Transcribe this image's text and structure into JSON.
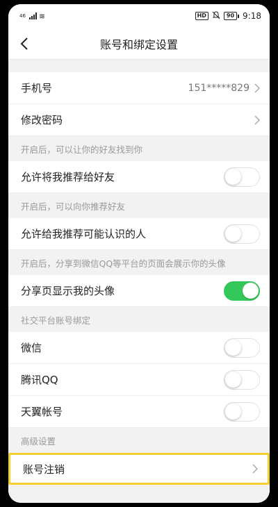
{
  "status_bar": {
    "network": "46",
    "hd": "HD",
    "battery": "90",
    "time": "9:18"
  },
  "nav": {
    "title": "账号和绑定设置"
  },
  "account": {
    "phone_label": "手机号",
    "phone_value": "151*****829",
    "password_label": "修改密码"
  },
  "sections": {
    "friends_find_hint": "开启后，可以让你的好友找到你",
    "recommend_me_label": "允许将我推荐给好友",
    "recommend_you_hint": "开启后，可以向你推荐好友",
    "recommend_known_label": "允许给我推荐可能认识的人",
    "share_avatar_hint": "开启后，分享到微信QQ等平台的页面会展示你的头像",
    "share_avatar_label": "分享页显示我的头像",
    "social_binding_header": "社交平台账号绑定",
    "wechat_label": "微信",
    "qq_label": "腾讯QQ",
    "tianyi_label": "天翼帐号",
    "advanced_header": "高级设置",
    "deactivate_label": "账号注销"
  },
  "toggles": {
    "recommend_me": false,
    "recommend_known": false,
    "share_avatar": true,
    "wechat": false,
    "qq": false,
    "tianyi": false
  },
  "colors": {
    "toggle_on": "#34c759",
    "highlight": "#f5d033"
  }
}
